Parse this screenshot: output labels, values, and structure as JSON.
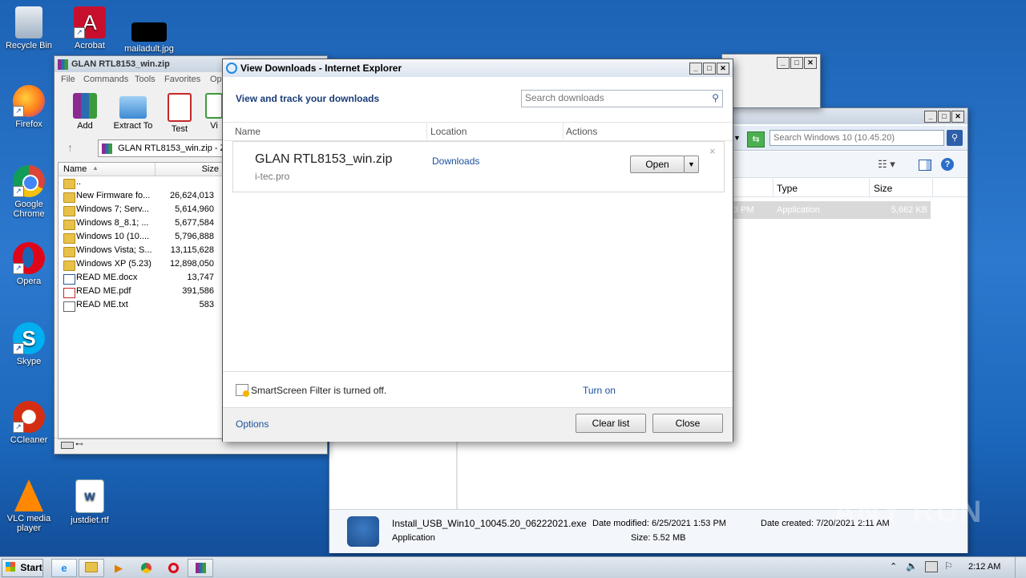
{
  "desktop": {
    "icons": [
      {
        "label": "Recycle Bin"
      },
      {
        "label": "Acrobat"
      },
      {
        "label": "mailadult.jpg"
      },
      {
        "label": "Firefox"
      },
      {
        "label": "Google Chrome"
      },
      {
        "label": "Opera"
      },
      {
        "label": "Skype"
      },
      {
        "label": "CCleaner"
      },
      {
        "label": "VLC media player"
      },
      {
        "label": "justdiet.rtf"
      }
    ]
  },
  "winrar": {
    "title": "GLAN RTL8153_win.zip",
    "menu": [
      "File",
      "Commands",
      "Tools",
      "Favorites",
      "Op"
    ],
    "toolbar": [
      "Add",
      "Extract To",
      "Test",
      "Vi"
    ],
    "path": "GLAN RTL8153_win.zip - ZI",
    "columns": {
      "name": "Name",
      "size": "Size"
    },
    "rows": [
      {
        "name": "..",
        "size": ""
      },
      {
        "name": "New Firmware fo...",
        "size": "26,624,013"
      },
      {
        "name": "Windows 7; Serv...",
        "size": "5,614,960"
      },
      {
        "name": "Windows 8_8.1; ...",
        "size": "5,677,584"
      },
      {
        "name": "Windows 10 (10....",
        "size": "5,796,888"
      },
      {
        "name": "Windows Vista; S...",
        "size": "13,115,628"
      },
      {
        "name": "Windows XP (5.23)",
        "size": "12,898,050"
      },
      {
        "name": "READ ME.docx",
        "size": "13,747"
      },
      {
        "name": "READ ME.pdf",
        "size": "391,586"
      },
      {
        "name": "READ ME.txt",
        "size": "583"
      }
    ]
  },
  "explorer": {
    "search_placeholder": "Search Windows 10 (10.45.20)",
    "columns": {
      "type": "Type",
      "size": "Size"
    },
    "row": {
      "time": "3 PM",
      "type": "Application",
      "size": "5,662 KB"
    },
    "details": {
      "filename": "Install_USB_Win10_10045.20_06222021.exe",
      "kind": "Application",
      "modified": "Date modified: 6/25/2021 1:53 PM",
      "size": "Size: 5.52 MB",
      "created": "Date created: 7/20/2021 2:11 AM"
    }
  },
  "downloads": {
    "title": "View Downloads - Internet Explorer",
    "heading": "View and track your downloads",
    "search_placeholder": "Search downloads",
    "columns": {
      "name": "Name",
      "location": "Location",
      "actions": "Actions"
    },
    "item": {
      "name": "GLAN RTL8153_win.zip",
      "source": "i-tec.pro",
      "location": "Downloads",
      "action": "Open"
    },
    "smartscreen": "SmartScreen Filter is turned off.",
    "turn_on": "Turn on",
    "options": "Options",
    "clear_list": "Clear list",
    "close": "Close"
  },
  "taskbar": {
    "start": "Start",
    "clock": "2:12 AM"
  },
  "watermark": "ANY RUN"
}
